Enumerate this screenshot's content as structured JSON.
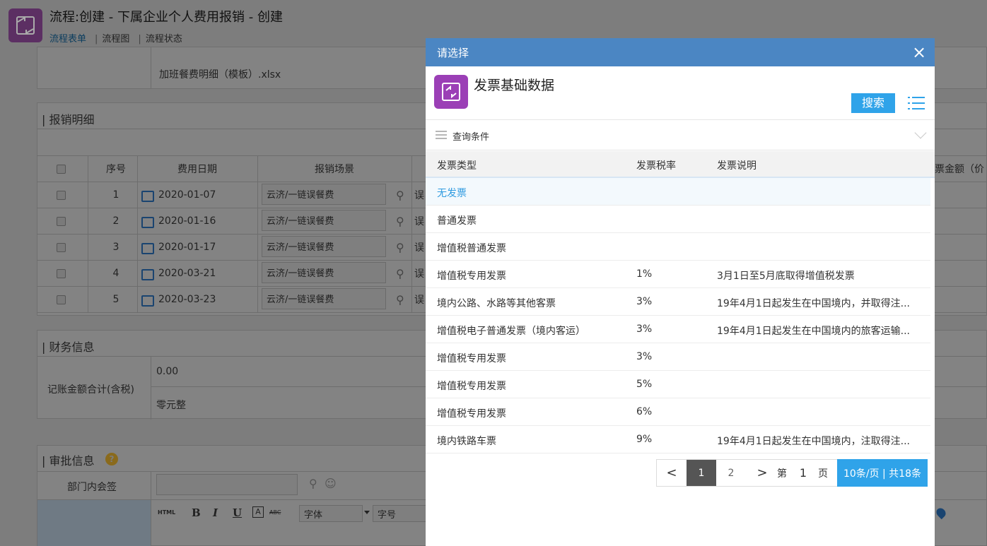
{
  "header": {
    "title": "流程:创建 - 下属企业个人费用报销 - 创建",
    "tabs": [
      {
        "label": "流程表单"
      },
      {
        "label": "流程图"
      },
      {
        "label": "流程状态"
      }
    ]
  },
  "attachment": {
    "filename": "加班餐费明细（模板）.xlsx"
  },
  "expense_section": {
    "title": "| 报销明细",
    "columns": [
      "序号",
      "费用日期",
      "报销场景",
      "票金额（价"
    ],
    "rows": [
      {
        "no": "1",
        "date": "2020-01-07",
        "scene": "云济/一链误餐费",
        "suffix": "误"
      },
      {
        "no": "2",
        "date": "2020-01-16",
        "scene": "云济/一链误餐费",
        "suffix": "误"
      },
      {
        "no": "3",
        "date": "2020-01-17",
        "scene": "云济/一链误餐费",
        "suffix": "误"
      },
      {
        "no": "4",
        "date": "2020-03-21",
        "scene": "云济/一链误餐费",
        "suffix": "误"
      },
      {
        "no": "5",
        "date": "2020-03-23",
        "scene": "云济/一链误餐费",
        "suffix": "误"
      }
    ]
  },
  "finance_section": {
    "title": "| 财务信息",
    "label": "记账金额合计(含税)",
    "amount": "0.00",
    "amount_text": "零元整"
  },
  "approval_section": {
    "title": "| 审批信息",
    "dept_label": "部门内会签",
    "editor": {
      "html": "HTML",
      "font": "字体",
      "size": "字号"
    }
  },
  "modal": {
    "title": "请选择",
    "close": "×",
    "heading": "发票基础数据",
    "search_label": "搜索",
    "query_label": "查询条件",
    "columns": [
      "发票类型",
      "发票税率",
      "发票说明"
    ],
    "rows": [
      {
        "type": "无发票",
        "rate": "",
        "desc": ""
      },
      {
        "type": "普通发票",
        "rate": "",
        "desc": ""
      },
      {
        "type": "增值税普通发票",
        "rate": "",
        "desc": ""
      },
      {
        "type": "增值税专用发票",
        "rate": "1%",
        "desc": "3月1日至5月底取得增值税发票"
      },
      {
        "type": "境内公路、水路等其他客票",
        "rate": "3%",
        "desc": "19年4月1日起发生在中国境内，并取得注..."
      },
      {
        "type": "增值税电子普通发票（境内客运）",
        "rate": "3%",
        "desc": "19年4月1日起发生在中国境内的旅客运输..."
      },
      {
        "type": "增值税专用发票",
        "rate": "3%",
        "desc": ""
      },
      {
        "type": "增值税专用发票",
        "rate": "5%",
        "desc": ""
      },
      {
        "type": "增值税专用发票",
        "rate": "6%",
        "desc": ""
      },
      {
        "type": "境内铁路车票",
        "rate": "9%",
        "desc": "19年4月1日起发生在中国境内，注取得注..."
      }
    ],
    "pager": {
      "prev": "<",
      "pages": [
        "1",
        "2"
      ],
      "next": ">",
      "goto_prefix": "第",
      "goto_value": "1",
      "goto_suffix": "页",
      "size_label": "10条/页 | 共18条"
    }
  },
  "colors": {
    "modal_header": "#4b86c3",
    "accent": "#2fa3e9",
    "app_icon": "#9b3fb6"
  }
}
